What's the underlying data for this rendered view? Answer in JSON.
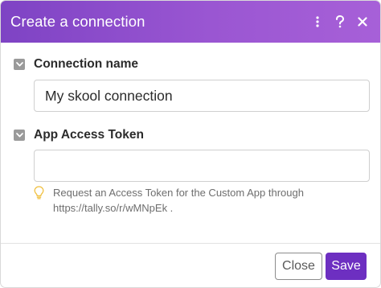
{
  "dialog": {
    "title": "Create a connection",
    "header_icons": [
      "more-vertical-icon",
      "help-icon",
      "close-icon"
    ]
  },
  "fields": [
    {
      "label": "Connection name",
      "value": "My skool connection",
      "placeholder": ""
    },
    {
      "label": "App Access Token",
      "value": "",
      "placeholder": "",
      "hint_line1": "Request an Access Token for the Custom App through",
      "hint_line2": "https://tally.so/r/wMNpEk ."
    }
  ],
  "footer": {
    "close_label": "Close",
    "save_label": "Save"
  },
  "colors": {
    "header_start": "#7e43c4",
    "header_end": "#a760d8",
    "primary": "#6d2fc1",
    "hint_icon": "#f0c040"
  }
}
